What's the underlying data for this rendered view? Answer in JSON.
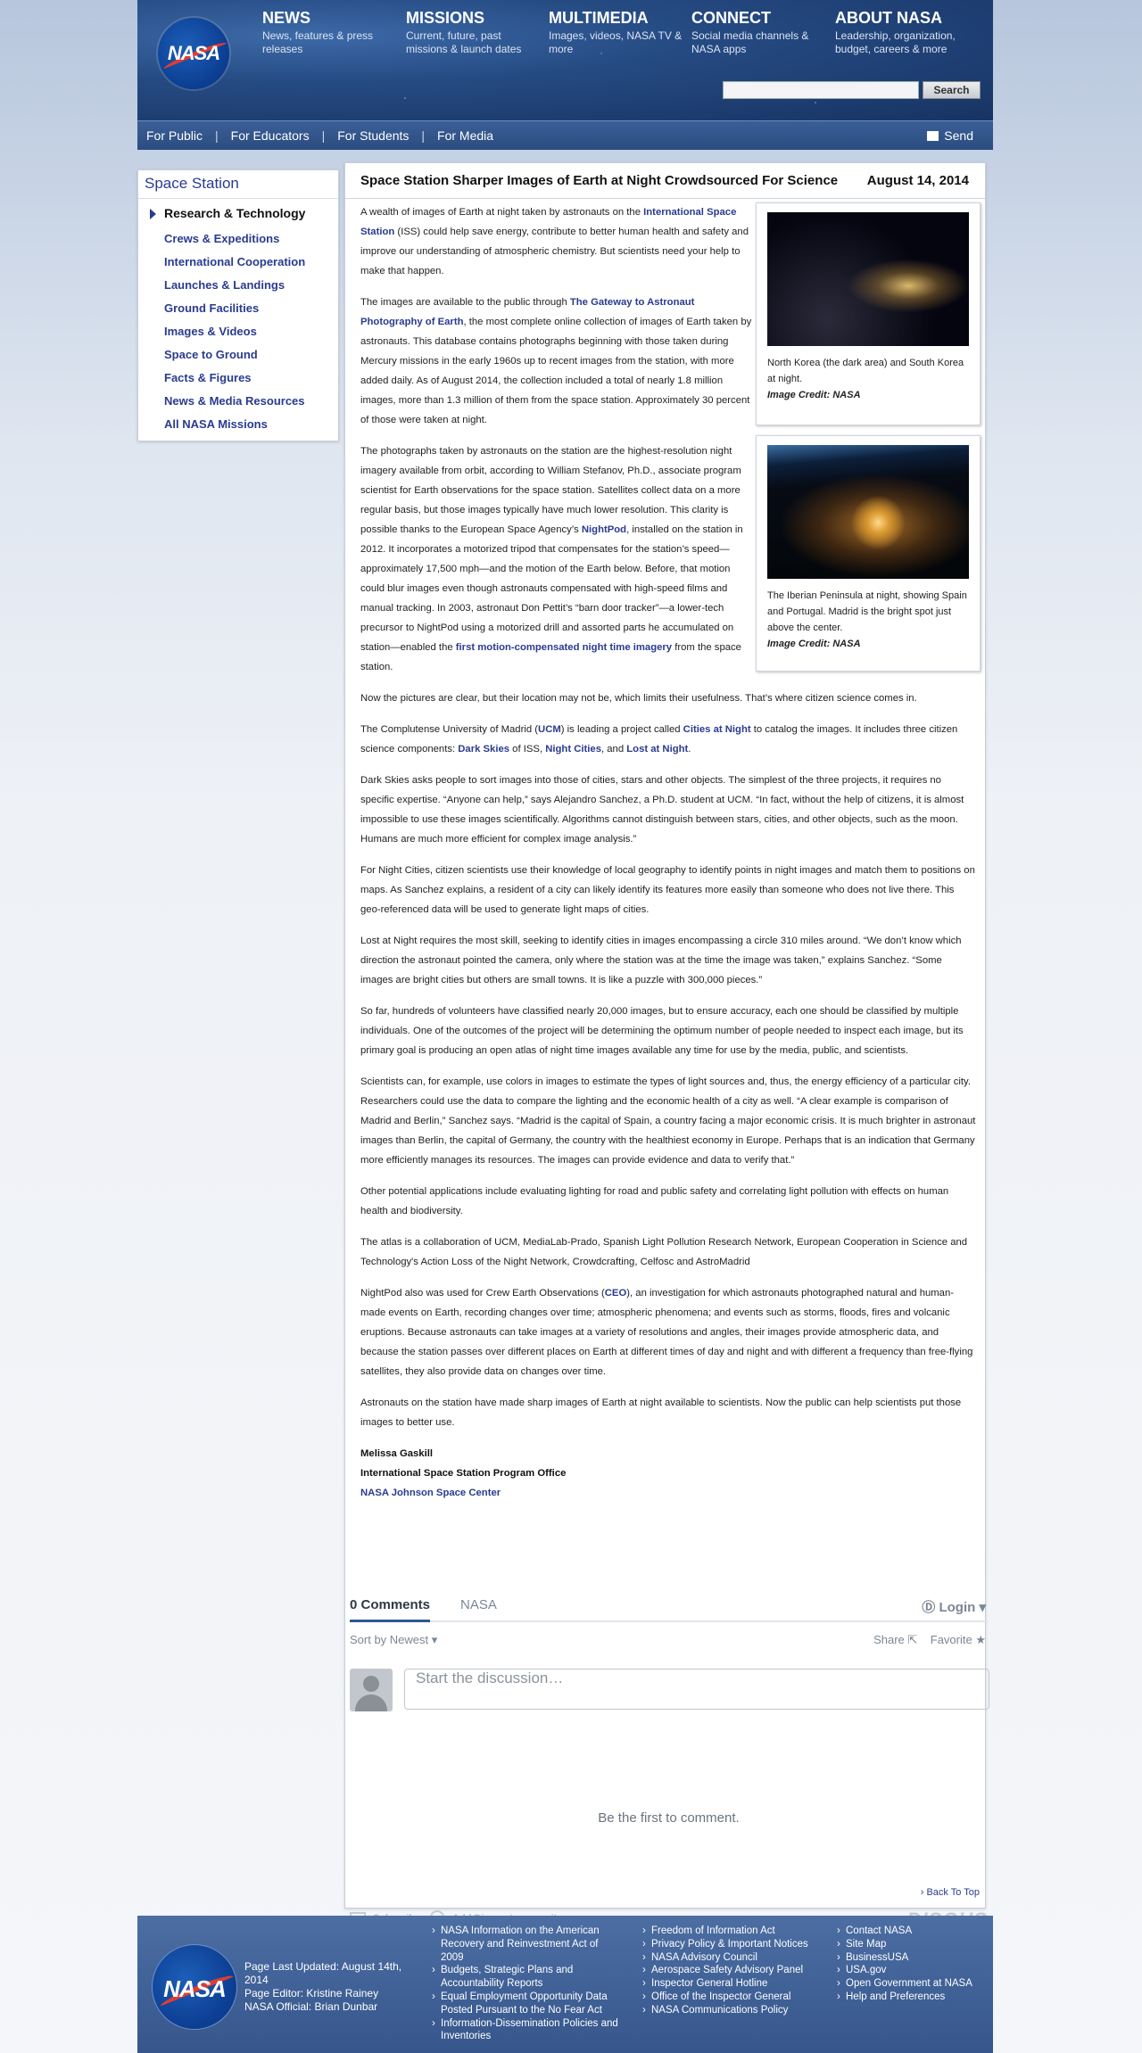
{
  "header": {
    "logo_text": "NASA",
    "nav": [
      {
        "title": "NEWS",
        "desc": "News, features & press releases"
      },
      {
        "title": "MISSIONS",
        "desc": "Current, future, past missions & launch dates"
      },
      {
        "title": "MULTIMEDIA",
        "desc": "Images, videos, NASA TV & more"
      },
      {
        "title": "CONNECT",
        "desc": "Social media channels & NASA apps"
      },
      {
        "title": "ABOUT NASA",
        "desc": "Leadership, organization, budget, careers & more"
      }
    ],
    "search_value": "",
    "search_button": "Search"
  },
  "subnav": {
    "items": [
      "For Public",
      "For Educators",
      "For Students",
      "For Media"
    ],
    "separator": "|",
    "send": "Send"
  },
  "sidebar": {
    "title": "Space Station",
    "current": "Research & Technology",
    "items": [
      "Crews & Expeditions",
      "International Cooperation",
      "Launches & Landings",
      "Ground Facilities",
      "Images & Videos",
      "Space to Ground",
      "Facts & Figures",
      "News & Media Resources",
      "All NASA Missions"
    ]
  },
  "article": {
    "title": "Space Station Sharper Images of Earth at Night Crowdsourced For Science",
    "date": "August 14, 2014",
    "p1_a": "A wealth of images of Earth at night taken by astronauts on the ",
    "p1_link": "International Space Station",
    "p1_b": " (ISS) could help save energy, contribute to better human health and safety and improve our understanding of atmospheric chemistry. But scientists need your help to make that happen.",
    "p2_a": "The images are available to the public through ",
    "p2_link": "The Gateway to Astronaut Photography of Earth",
    "p2_b": ", the most complete online collection of images of Earth taken by astronauts. This database contains photographs beginning with those taken during Mercury missions in the early 1960s up to recent images from the station, with more added daily. As of August 2014, the collection included a total of nearly 1.8 million images, more than 1.3 million of them from the space station. Approximately 30 percent of those were taken at night.",
    "p3_a": "The photographs taken by astronauts on the station are the highest-resolution night imagery available from orbit, according to William Stefanov, Ph.D., associate program scientist for Earth observations for the space station. Satellites collect data on a more regular basis, but those images typically have much lower resolution. This clarity is possible thanks to the European Space Agency’s ",
    "p3_link": "NightPod",
    "p3_b": ", installed on the station in 2012. It incorporates a motorized tripod that compensates for the station’s speed—approximately 17,500 mph—and the motion of the Earth below. Before, that motion could blur images even though astronauts compensated with high-speed films and manual tracking. In 2003, astronaut Don Pettit’s “barn door tracker”—a lower-tech precursor to NightPod using a motorized drill and assorted parts he accumulated on station—enabled the ",
    "p3_link2": "first motion-compensated night time imagery",
    "p3_c": " from the space station.",
    "p4": "Now the pictures are clear, but their location may not be, which limits their usefulness. That’s where citizen science comes in.",
    "p5_a": "The Complutense University of Madrid (",
    "p5_link1": "UCM",
    "p5_b": ") is leading a project called ",
    "p5_link2": "Cities at Night",
    "p5_c": " to catalog the images. It includes three citizen science components: ",
    "p5_link3": "Dark Skies",
    "p5_d": " of ISS, ",
    "p5_link4": "Night Cities",
    "p5_e": ", and ",
    "p5_link5": "Lost at Night",
    "p5_f": ".",
    "p6": "Dark Skies asks people to sort images into those of cities, stars and other objects. The simplest of the three projects, it requires no specific expertise. “Anyone can help,” says Alejandro Sanchez, a Ph.D. student at UCM. “In fact, without the help of citizens, it is almost impossible to use these images scientifically. Algorithms cannot distinguish between stars, cities, and other objects, such as the moon. Humans are much more efficient for complex image analysis.”",
    "p7": "For Night Cities, citizen scientists use their knowledge of local geography to identify points in night images and match them to positions on maps. As Sanchez explains, a resident of a city can likely identify its features more easily than someone who does not live there. This geo-referenced data will be used to generate light maps of cities.",
    "p8": "Lost at Night requires the most skill, seeking to identify cities in images encompassing a circle 310 miles around. “We don’t know which direction the astronaut pointed the camera, only where the station was at the time the image was taken,” explains Sanchez. “Some images are bright cities but others are small towns. It is like a puzzle with 300,000 pieces.”",
    "p9": "So far, hundreds of volunteers have classified nearly 20,000 images, but to ensure accuracy, each one should be classified by multiple individuals. One of the outcomes of the project will be determining the optimum number of people needed to inspect each image, but its primary goal is producing an open atlas of night time images available any time for use by the media, public, and scientists.",
    "p10": "Scientists can, for example, use colors in images to estimate the types of light sources and, thus, the energy efficiency of a particular city. Researchers could use the data to compare the lighting and the economic health of a city as well. “A clear example is comparison of Madrid and Berlin,” Sanchez says. “Madrid is the capital of Spain, a country facing a major economic crisis. It is much brighter in astronaut images than Berlin, the capital of Germany, the country with the healthiest economy in Europe. Perhaps that is an indication that Germany more efficiently manages its resources. The images can provide evidence and data to verify that.”",
    "p11": "Other potential applications include evaluating lighting for road and public safety and correlating light pollution with effects on human health and biodiversity.",
    "p12": "The atlas is a collaboration of UCM, MediaLab-Prado, Spanish Light Pollution Research Network, European Cooperation in Science and Technology's Action Loss of the Night Network, Crowdcrafting, Celfosc and AstroMadrid",
    "p13_a": "NightPod also was used for Crew Earth Observations (",
    "p13_link": "CEO",
    "p13_b": "), an investigation for which astronauts photographed natural and human-made events on Earth, recording changes over time; atmospheric phenomena; and events such as storms, floods, fires and volcanic eruptions. Because astronauts can take images at a variety of resolutions and angles, their images provide atmospheric data, and because the station passes over different places on Earth at different times of day and night and with different a frequency than free-flying satellites, they also provide data on changes over time.",
    "p14": "Astronauts on the station have made sharp images of Earth at night available to scientists. Now the public can help scientists put those images to better use.",
    "author": "Melissa Gaskill",
    "office": "International Space Station Program Office",
    "center": "NASA Johnson Space Center"
  },
  "figures": [
    {
      "caption": "North Korea (the dark area) and South Korea at night.",
      "credit": "Image Credit: NASA"
    },
    {
      "caption": "The Iberian Peninsula at night, showing Spain and Portugal. Madrid is the bright spot just above the center.",
      "credit": "Image Credit: NASA"
    }
  ],
  "comments": {
    "count_tab": "0 Comments",
    "site_tab": "NASA",
    "login": "Login",
    "sort": "Sort by Newest",
    "share": "Share",
    "favorite": "Favorite",
    "placeholder": "Start the discussion…",
    "empty": "Be the first to comment.",
    "subscribe": "Subscribe",
    "add_disqus": "Add Disqus to your site",
    "brand": "DISQUS"
  },
  "back_to_top": "› Back To Top",
  "footer": {
    "logo_text": "NASA",
    "last_updated": "Page Last Updated: August 14th, 2014",
    "editor": "Page Editor: Kristine Rainey",
    "official": "NASA Official: Brian Dunbar",
    "col1": [
      "NASA Information on the American Recovery and Reinvestment Act of 2009",
      "Budgets, Strategic Plans and Accountability Reports",
      "Equal Employment Opportunity Data Posted Pursuant to the No Fear Act",
      "Information-Dissemination Policies and Inventories"
    ],
    "col2": [
      "Freedom of Information Act",
      "Privacy Policy & Important Notices",
      "NASA Advisory Council",
      "Aerospace Safety Advisory Panel",
      "Inspector General Hotline",
      "Office of the Inspector General",
      "NASA Communications Policy"
    ],
    "col3": [
      "Contact NASA",
      "Site Map",
      "BusinessUSA",
      "USA.gov",
      "Open Government at NASA",
      "Help and Preferences"
    ]
  }
}
